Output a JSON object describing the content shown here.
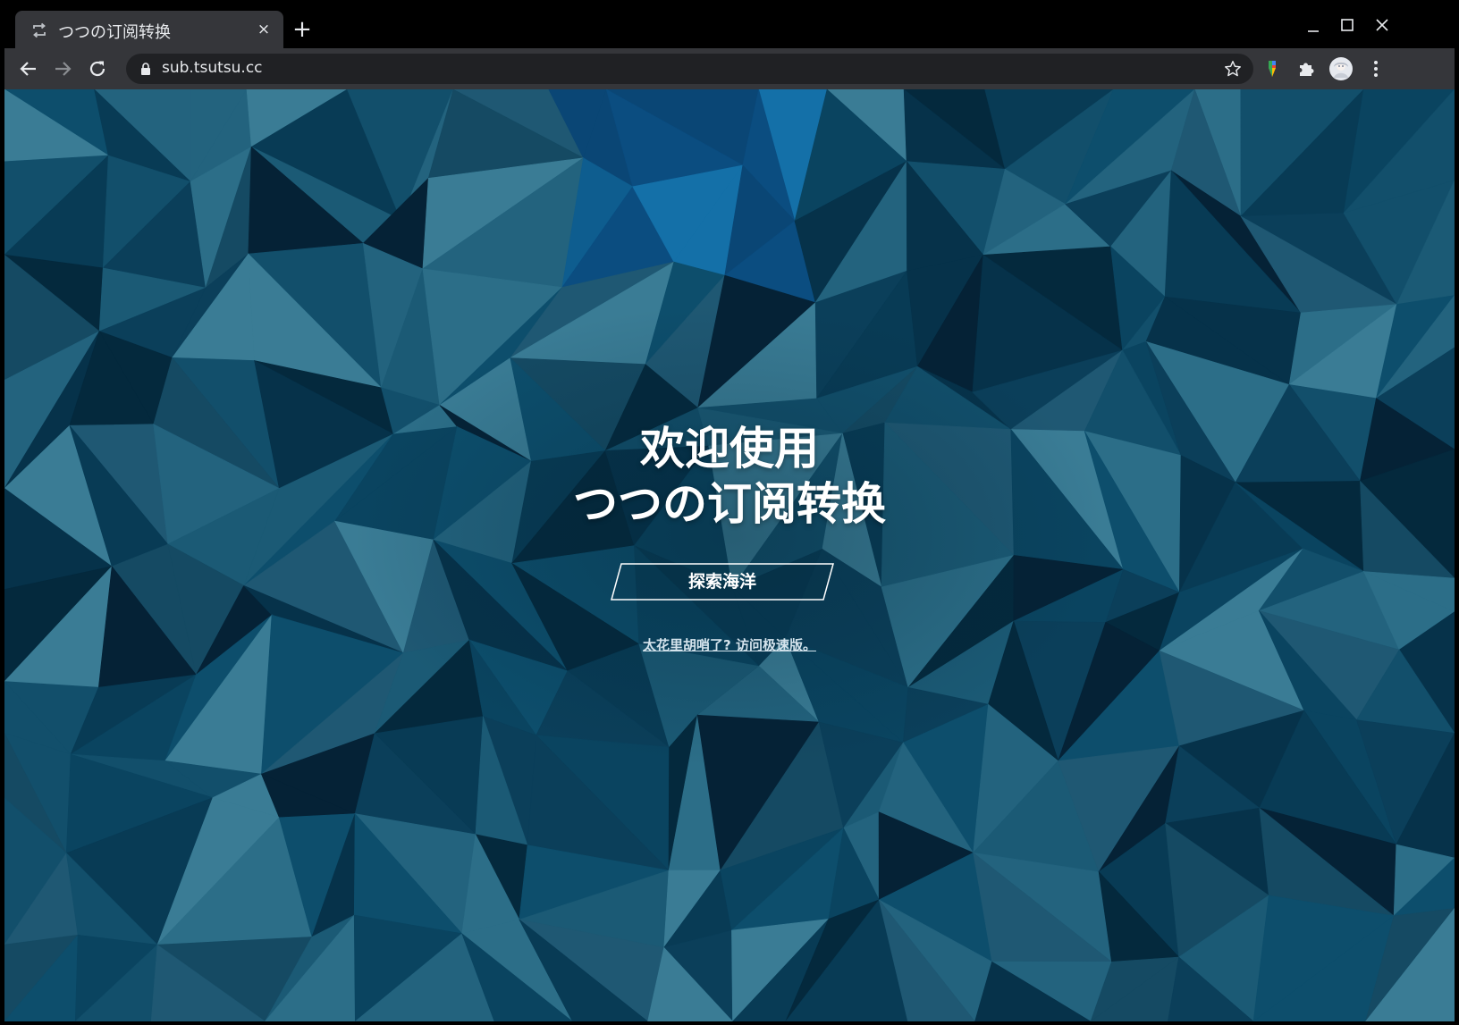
{
  "browser": {
    "tab": {
      "title": "つつの订阅转换",
      "favicon": "sync-arrows-icon",
      "close": "×"
    },
    "new_tab": "+",
    "url": "sub.tsutsu.cc",
    "window_controls": [
      "minimize-icon",
      "maximize-icon",
      "close-icon"
    ],
    "toolbar_icons": [
      "back-arrow-icon",
      "forward-arrow-icon",
      "reload-icon",
      "lock-icon",
      "bookmark-star-icon",
      "color-extension-icon",
      "puzzle-extensions-icon",
      "profile-avatar",
      "menu-dots-icon"
    ]
  },
  "page": {
    "headline_line1": "欢迎使用",
    "headline_line2": "つつの订阅转换",
    "explore_button": "探索海洋",
    "fast_link": "太花里胡哨了? 访问极速版。"
  },
  "colors": {
    "background": "#05334a",
    "chrome_dark": "#202124",
    "chrome_tab": "#35363a",
    "text": "#ffffff"
  }
}
